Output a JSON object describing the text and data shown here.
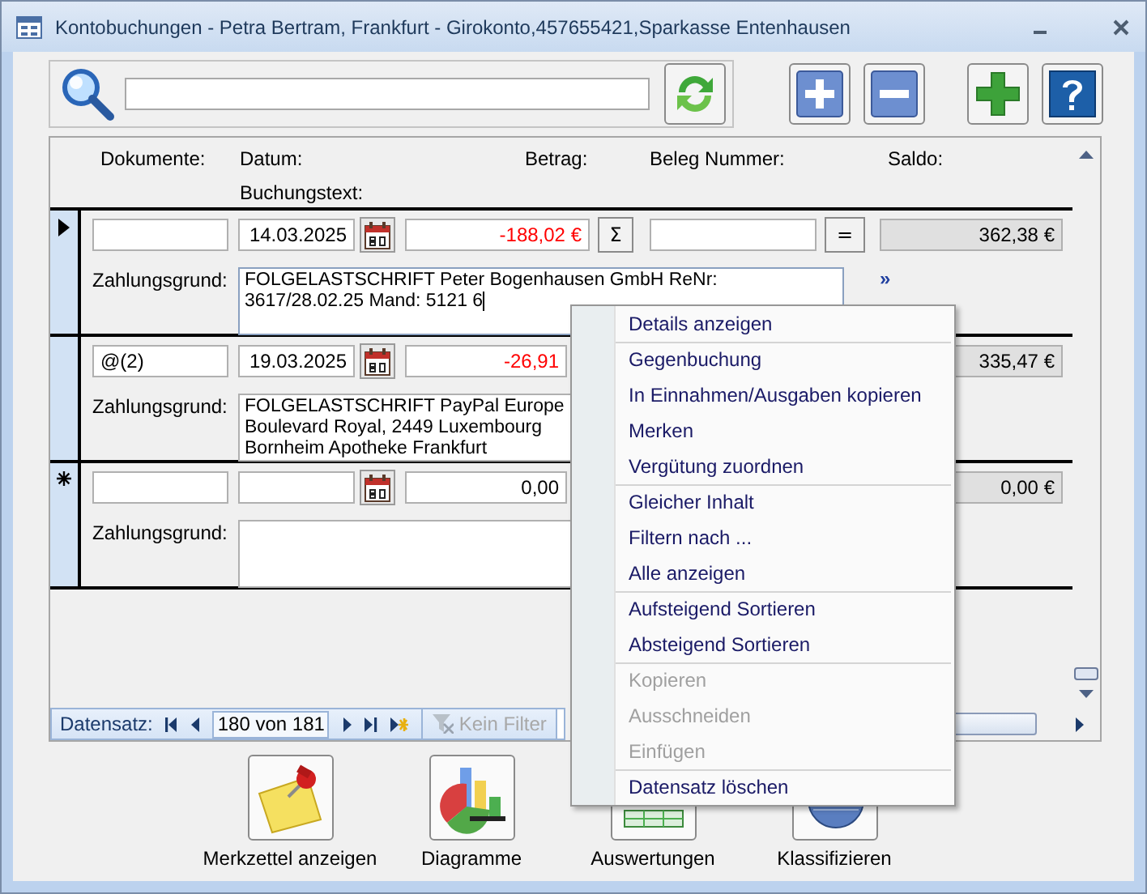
{
  "window": {
    "title": "Kontobuchungen - Petra Bertram, Frankfurt - Girokonto,457655421,Sparkasse Entenhausen"
  },
  "toolbar": [
    {
      "kind": "add"
    },
    {
      "kind": "remove"
    },
    {
      "kind": "new"
    },
    {
      "kind": "help"
    }
  ],
  "header": {
    "dokumente": "Dokumente:",
    "datum": "Datum:",
    "betrag": "Betrag:",
    "beleg": "Beleg Nummer:",
    "saldo": "Saldo:",
    "buchungstext": "Buchungstext:"
  },
  "records": [
    {
      "kind": "record",
      "selected": true,
      "date": "14.03.2025",
      "amount": "-188,02 €",
      "negative": true,
      "sum_button": "Σ",
      "beleg_field": true,
      "equals_button": "=",
      "saldo": "362,38 €",
      "reason_label": "Zahlungsgrund:",
      "reason": [
        "FOLGELASTSCHRIFT Peter Bogenhausen GmbH ReNr:",
        "3617/28.02.25 Mand: 5121 6"
      ],
      "focused": true,
      "more": "»"
    },
    {
      "kind": "record",
      "selected": false,
      "documents": "@(2)",
      "date": "19.03.2025",
      "amount": "-26,91",
      "negative": true,
      "beleg_field": false,
      "saldo": "335,47 €",
      "reason_label": "Zahlungsgrund:",
      "reason": [
        "FOLGELASTSCHRIFT PayPal Europe",
        "Boulevard Royal, 2449 Luxembourg",
        "Bornheim Apotheke Frankfurt"
      ],
      "focused": false
    },
    {
      "kind": "new_record",
      "selected": false,
      "amount": "0,00",
      "negative": false,
      "beleg_field": false,
      "saldo": "0,00 €",
      "reason_label": "Zahlungsgrund:",
      "focused": false
    }
  ],
  "navigation": {
    "label": "Datensatz:",
    "position": "180 von 181",
    "filter": "Kein Filter",
    "filter_disabled": true
  },
  "bottom_buttons": [
    {
      "kind": "note",
      "label": "Merkzettel anzeigen"
    },
    {
      "kind": "chart",
      "label": "Diagramme"
    },
    {
      "kind": "report",
      "label": "Auswertungen"
    },
    {
      "kind": "classify",
      "label": "Klassifizieren"
    }
  ],
  "context_menu": [
    {
      "label": "Details anzeigen",
      "disabled": false,
      "separator_before": false
    },
    {
      "label": "Gegenbuchung",
      "disabled": false,
      "separator_before": true
    },
    {
      "label": "In Einnahmen/Ausgaben kopieren",
      "disabled": false,
      "separator_before": false
    },
    {
      "label": "Merken",
      "disabled": false,
      "separator_before": false
    },
    {
      "label": "Vergütung zuordnen",
      "disabled": false,
      "separator_before": false
    },
    {
      "label": "Gleicher Inhalt",
      "disabled": false,
      "separator_before": true
    },
    {
      "label": "Filtern nach ...",
      "disabled": false,
      "separator_before": false
    },
    {
      "label": "Alle anzeigen",
      "disabled": false,
      "separator_before": false
    },
    {
      "label": "Aufsteigend Sortieren",
      "disabled": false,
      "separator_before": true
    },
    {
      "label": "Absteigend Sortieren",
      "disabled": false,
      "separator_before": false
    },
    {
      "label": "Kopieren",
      "disabled": true,
      "separator_before": true
    },
    {
      "label": "Ausschneiden",
      "disabled": true,
      "separator_before": false
    },
    {
      "label": "Einfügen",
      "disabled": true,
      "separator_before": false
    },
    {
      "label": "Datensatz löschen",
      "disabled": false,
      "separator_before": true
    }
  ]
}
